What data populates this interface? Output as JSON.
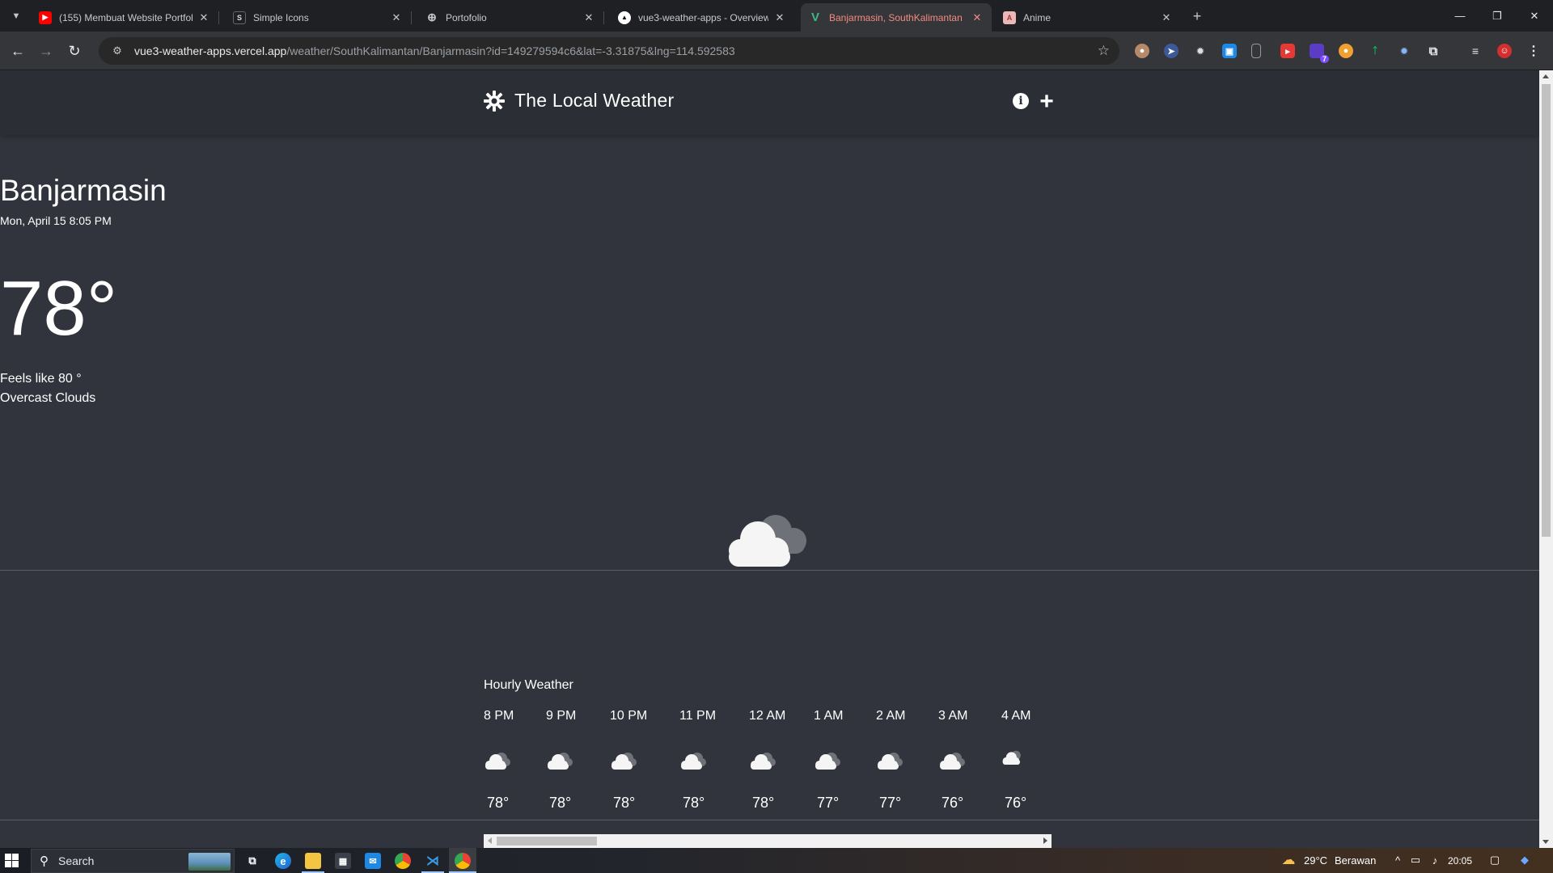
{
  "browser": {
    "tabs": [
      {
        "title": "(155) Membuat Website Portfoli",
        "favicon": "youtube-icon",
        "active": false
      },
      {
        "title": "Simple Icons",
        "favicon": "simple-icons-icon",
        "active": false
      },
      {
        "title": "Portofolio",
        "favicon": "globe-icon",
        "active": false
      },
      {
        "title": "vue3-weather-apps - Overview",
        "favicon": "vercel-icon",
        "active": false
      },
      {
        "title": "Banjarmasin, SouthKalimantan",
        "favicon": "vue-icon",
        "active": true
      },
      {
        "title": "Anime",
        "favicon": "anime-icon",
        "active": false
      }
    ],
    "url_host": "vue3-weather-apps.vercel.app",
    "url_path": "/weather/SouthKalimantan/Banjarmasin?id=149279594c6&lat=-3.31875&lng=114.592583",
    "extension_badge": "7"
  },
  "app": {
    "title": "The Local Weather",
    "city": "Banjarmasin",
    "datetime": "Mon, April 15 8:05 PM",
    "temperature": "78°",
    "feels_like": "Feels like 80 °",
    "description": "Overcast Clouds",
    "hourly_title": "Hourly Weather",
    "hourly": [
      {
        "time": "8 PM",
        "temp": "78°"
      },
      {
        "time": "9 PM",
        "temp": "78°"
      },
      {
        "time": "10 PM",
        "temp": "78°"
      },
      {
        "time": "11 PM",
        "temp": "78°"
      },
      {
        "time": "12 AM",
        "temp": "78°"
      },
      {
        "time": "1 AM",
        "temp": "77°"
      },
      {
        "time": "2 AM",
        "temp": "77°"
      },
      {
        "time": "3 AM",
        "temp": "76°"
      },
      {
        "time": "4 AM",
        "temp": "76°"
      }
    ]
  },
  "taskbar": {
    "search_placeholder": "Search",
    "weather_temp": "29°C",
    "weather_desc": "Berawan",
    "clock": "20:05"
  },
  "colors": {
    "page_bg": "#32343d",
    "header_bg": "#2c2e35",
    "active_tab_text": "#f28b82"
  }
}
